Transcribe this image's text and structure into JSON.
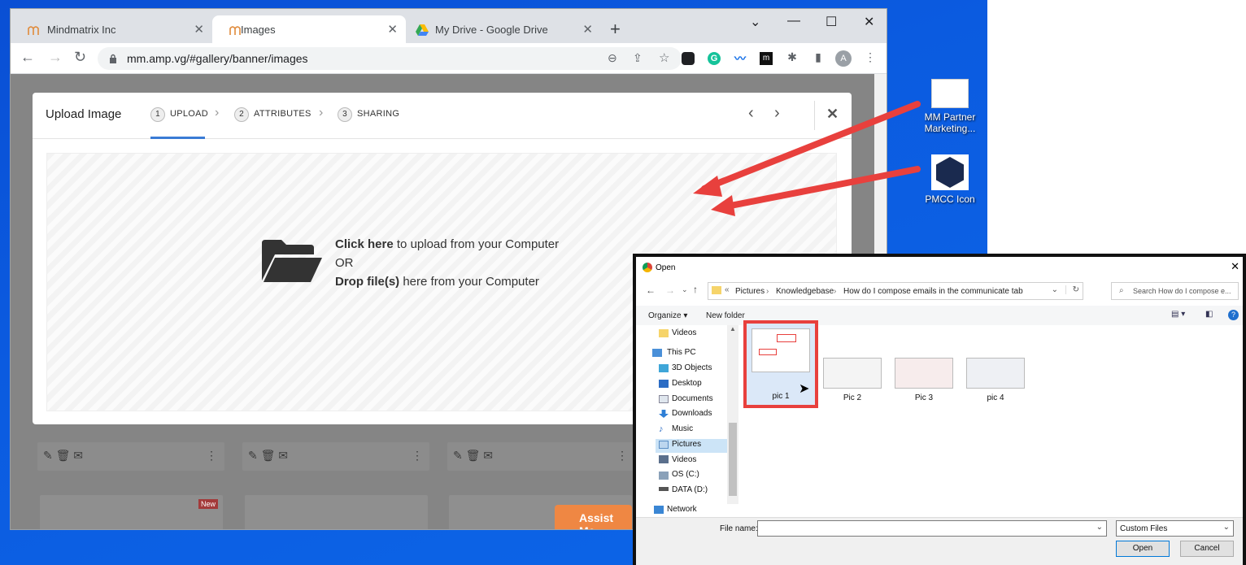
{
  "browser": {
    "tabs": [
      {
        "label": "Mindmatrix Inc",
        "close": "✕"
      },
      {
        "label": "Images",
        "close": "✕"
      },
      {
        "label": "My Drive - Google Drive",
        "close": "✕"
      }
    ],
    "new_tab": "+",
    "url": "mm.amp.vg/#gallery/banner/images",
    "profile_initial": "A"
  },
  "modal": {
    "title": "Upload Image",
    "steps": [
      {
        "num": "1",
        "label": "UPLOAD"
      },
      {
        "num": "2",
        "label": "ATTRIBUTES"
      },
      {
        "num": "3",
        "label": "SHARING"
      }
    ],
    "dropzone": {
      "click_bold": "Click here",
      "click_rest": " to upload from your Computer",
      "or": "OR",
      "drop_bold": "Drop file(s)",
      "drop_rest": " here from your Computer"
    }
  },
  "page": {
    "new_badge": "New",
    "assist_label": "Assist Me"
  },
  "desktop": {
    "icons": [
      {
        "label": "MM Partner Marketing..."
      },
      {
        "label": "PMCC Icon"
      }
    ]
  },
  "dialog": {
    "title": "Open",
    "path": [
      "Pictures",
      "Knowledgebase",
      "How do I compose emails in the communicate tab"
    ],
    "path_prefix": "«",
    "search_placeholder": "Search How do I compose e...",
    "organize": "Organize ▾",
    "new_folder": "New folder",
    "nav_items": [
      "Videos",
      "This PC",
      "3D Objects",
      "Desktop",
      "Documents",
      "Downloads",
      "Music",
      "Pictures",
      "Videos",
      "OS (C:)",
      "DATA (D:)",
      "Network"
    ],
    "files": [
      "pic 1",
      "Pic 2",
      "Pic 3",
      "pic 4"
    ],
    "file_name_label": "File name:",
    "file_name_value": "",
    "file_type": "Custom Files",
    "open_button": "Open",
    "cancel_button": "Cancel"
  },
  "colors": {
    "desktop": "#0b5be0",
    "arrow": "#e8403d",
    "assist": "#ef8743",
    "step_accent": "#3a7bd5"
  }
}
